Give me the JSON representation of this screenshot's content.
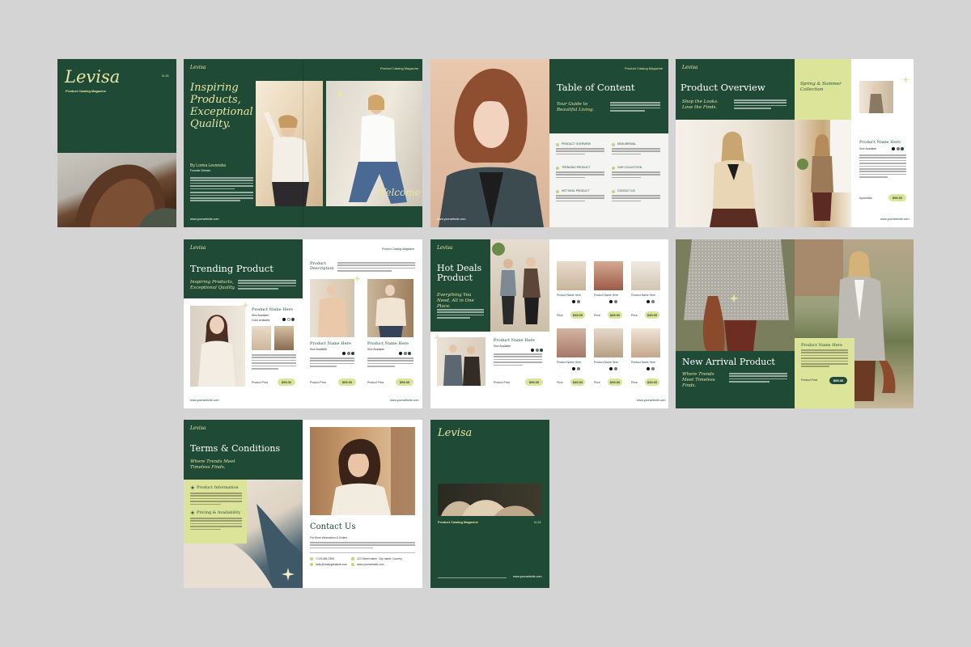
{
  "brand": "Levisa",
  "cover": {
    "title": "Levisa",
    "subtitle": "Product Catalog Magazine",
    "edition": "N.15",
    "website": "www.yourwebsite.com"
  },
  "welcome": {
    "header_brand": "Levisa",
    "header_label": "Product Catalog Magazine",
    "headline": "Inspiring Products, Exceptional Quality.",
    "byline": "By Lorina Levonska",
    "byline_role": "Founder Director",
    "welcome_word": "Welcome",
    "website": "www.yourwebsite.com"
  },
  "toc": {
    "header_label": "Product Catalog Magazine",
    "title": "Table of Content",
    "tagline": "Your Guide to Beautiful Living.",
    "items": [
      "PRODUCT OVERVIEW",
      "NEW ARRIVAL",
      "TRENDING PRODUCT",
      "OUR COLLECTION",
      "HOT DEAL PRODUCT",
      "CONTACT US"
    ],
    "website": "www.yourwebsite.com"
  },
  "overview": {
    "header_brand": "Levisa",
    "header_label": "Product Catalog Magazine",
    "title": "Product Overview",
    "tagline": "Shop the Looks. Love the Finds.",
    "collection": "Spring & Summer Collection",
    "product_name": "Product Name Here",
    "size_label": "Size Available",
    "colors_label": "Colors Available",
    "price_label": "Ayurchase",
    "price": "$99.00",
    "website": "www.yourwebsite.com"
  },
  "trending": {
    "header_brand": "Levisa",
    "header_label": "Product Catalog Magazine",
    "title": "Trending Product",
    "tagline": "Inspiring Products, Exceptional Quality.",
    "desc_title": "Product Description",
    "product_name": "Product Name Here",
    "size_label": "Size Available",
    "colors_label": "Color Available",
    "price_label": "Product Price",
    "price": "$99.00",
    "website": "www.yourwebsite.com"
  },
  "hotdeals": {
    "header_brand": "Levisa",
    "title": "Hot Deals Product",
    "tagline": "Everything You Need, All in One Place.",
    "product_name": "Product Name Here",
    "size_label": "Size Available",
    "price_label": "Product Price",
    "price": "$99.00",
    "grid_price": "$49.00",
    "grid_price_label": "Price",
    "website": "www.yourwebsite.com"
  },
  "newarrival": {
    "title": "New Arrival Product",
    "tagline": "Where Trends Meet Timeless Finds.",
    "product_name": "Product Name Here",
    "price_label": "Product Price",
    "price": "$99.00"
  },
  "terms": {
    "header_brand": "Levisa",
    "title": "Terms & Conditions",
    "tagline": "Where Trends Meet Timeless Finds.",
    "section1": "Product Information",
    "section2": "Pricing & Availability"
  },
  "contact": {
    "title": "Contact Us",
    "subtitle": "For More Information & Orders",
    "phone": "+123-456-7890",
    "address": "123 Street name, City name, Country",
    "email": "hello@reallygreatsite.com",
    "site": "www.yourwebsite.com"
  },
  "backcover": {
    "title": "Levisa",
    "subtitle": "Product Catalog Magazine",
    "edition": "N.15",
    "website": "www.yourwebsite.com"
  },
  "colors": {
    "background": "#d4d4d4",
    "green": "#1f4a36",
    "lime": "#dce49a",
    "cream_text": "#e8e6a4"
  }
}
